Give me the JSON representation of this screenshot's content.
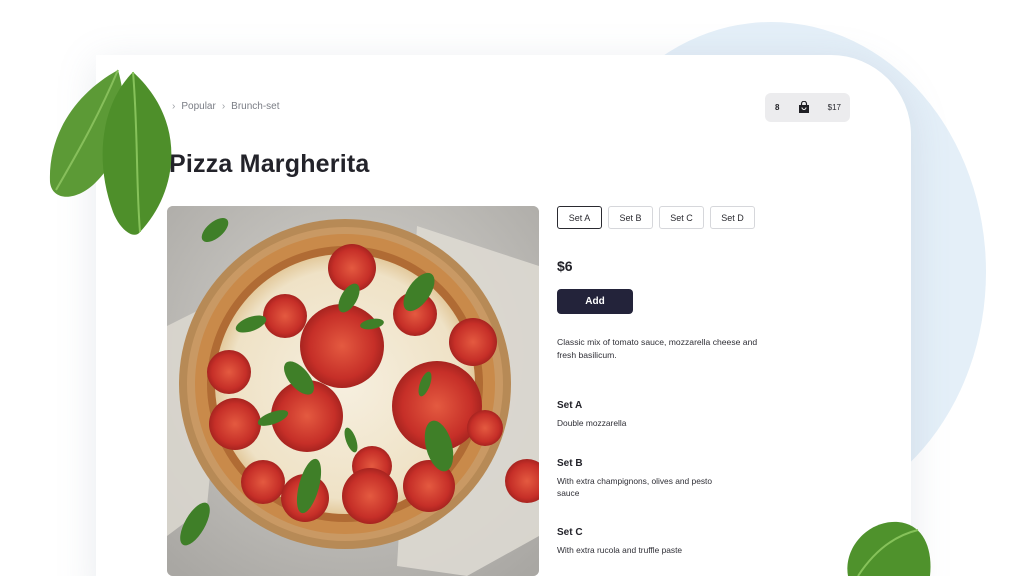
{
  "breadcrumb": {
    "items": [
      "Popular",
      "Brunch-set"
    ]
  },
  "cart": {
    "count": "8",
    "total": "$17",
    "icon": "shopping-bag-icon"
  },
  "product": {
    "title": "Pizza Margherita",
    "price": "$6",
    "add_label": "Add",
    "description": "Classic mix of tomato sauce, mozzarella cheese and fresh basilicum."
  },
  "set_options": [
    {
      "label": "Set A",
      "selected": true
    },
    {
      "label": "Set B",
      "selected": false
    },
    {
      "label": "Set C",
      "selected": false
    },
    {
      "label": "Set D",
      "selected": false
    }
  ],
  "sets": [
    {
      "name": "Set A",
      "detail": "Double mozzarella"
    },
    {
      "name": "Set B",
      "detail": "With extra champignons, olives and pesto sauce"
    },
    {
      "name": "Set C",
      "detail": "With extra rucola and truffle paste"
    }
  ],
  "colors": {
    "accent_dark": "#23233a",
    "background_blob": "#e4eff8",
    "basil": "#4a8f2c",
    "tomato": "#c8302a"
  }
}
